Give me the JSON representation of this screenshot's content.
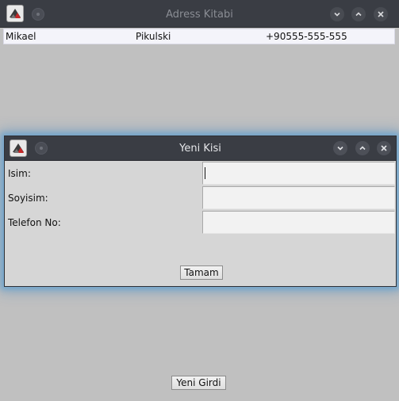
{
  "main_window": {
    "title": "Adress Kitabi",
    "entries": [
      {
        "first_name": "Mikael",
        "last_name": "Pikulski",
        "phone": "+90555-555-555"
      }
    ],
    "new_entry_button": "Yeni Girdi"
  },
  "dialog": {
    "title": "Yeni Kisi",
    "fields": [
      {
        "label": "Isim:",
        "value": ""
      },
      {
        "label": "Soyisim:",
        "value": ""
      },
      {
        "label": "Telefon No:",
        "value": ""
      }
    ],
    "ok_button": "Tamam"
  },
  "icons": {
    "app": "app-icon",
    "window_menu": "window-menu-icon",
    "minimize": "minimize-icon",
    "maximize": "maximize-icon",
    "close": "close-icon"
  },
  "colors": {
    "titlebar": "#3a3d44",
    "window_bg": "#c0c0c0",
    "dialog_bg": "#d6d6d6",
    "dialog_glow": "#50a0dc",
    "list_bg": "#f4f4fa"
  }
}
